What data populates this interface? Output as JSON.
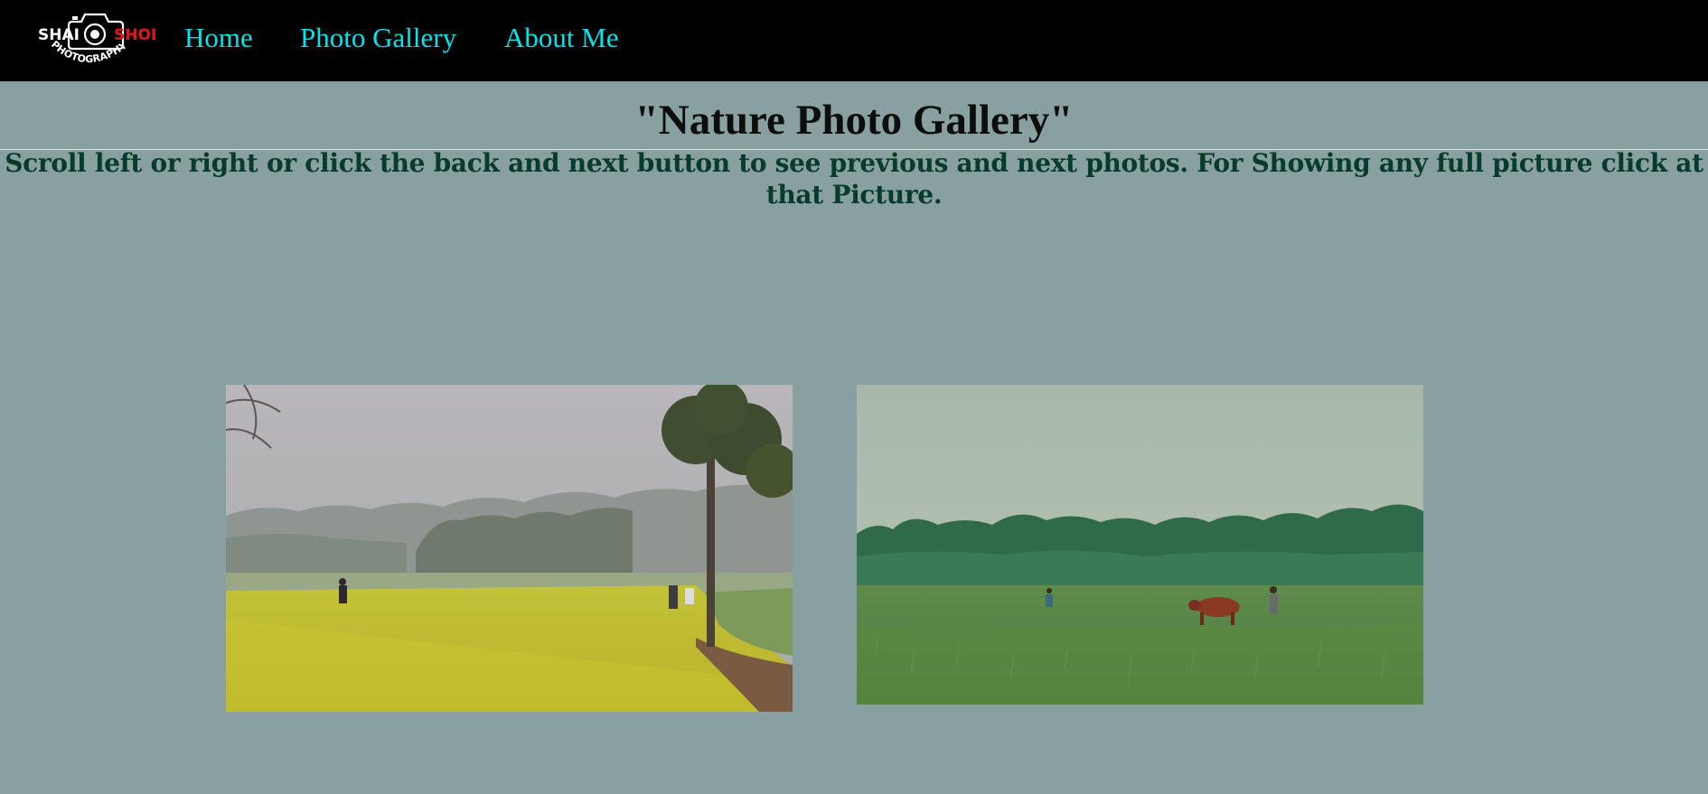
{
  "nav": {
    "logo": {
      "text_left": "SHAI",
      "text_right": "SHOB",
      "subtitle": "PHOTOGRAPHY"
    },
    "links": [
      "Home",
      "Photo Gallery",
      "About Me"
    ]
  },
  "page": {
    "title": "\"Nature Photo Gallery\"",
    "instructions": "Scroll left or right or click the back and next button to see previous and next photos. For Showing any full picture click at that Picture."
  },
  "colors": {
    "nav_background": "#000000",
    "nav_link": "#00e5ee",
    "page_background": "#89a0a0",
    "instructions_text": "#073b2b"
  }
}
